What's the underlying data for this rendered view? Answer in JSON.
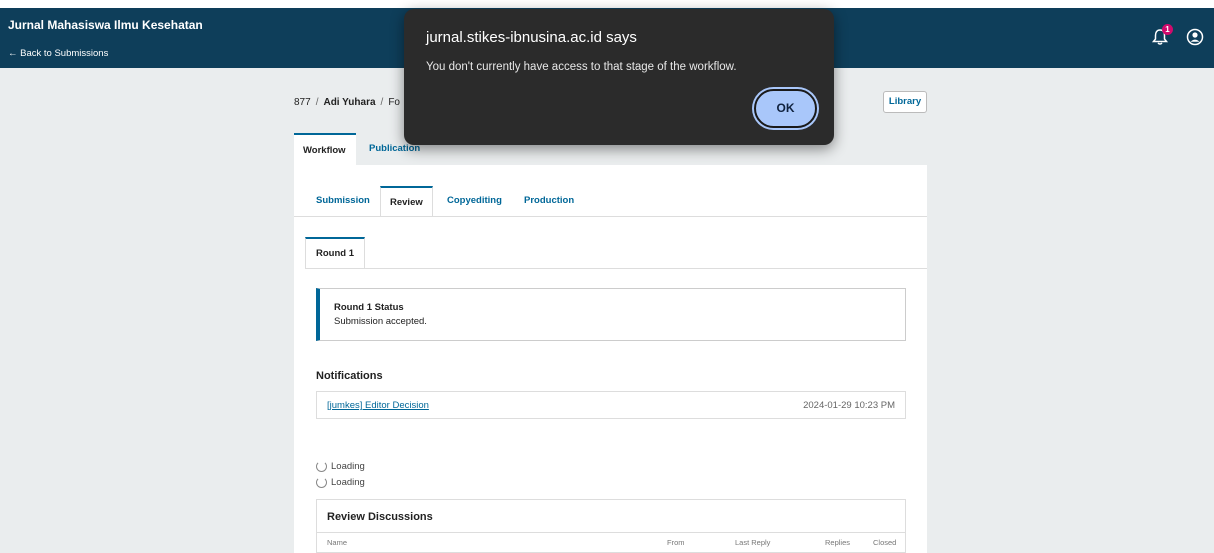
{
  "header": {
    "journal_title": "Jurnal Mahasiswa Ilmu Kesehatan",
    "back_link": "← Back to Submissions",
    "notification_count": "1",
    "color": "#0e3e5a"
  },
  "breadcrumb": {
    "id": "877",
    "author": "Adi Yuhara",
    "title_fragment": "Fo"
  },
  "library_button": "Library",
  "main_tabs": [
    {
      "label": "Workflow",
      "active": true
    },
    {
      "label": "Publication",
      "active": false
    }
  ],
  "stage_tabs": [
    {
      "label": "Submission",
      "active": false
    },
    {
      "label": "Review",
      "active": true
    },
    {
      "label": "Copyediting",
      "active": false
    },
    {
      "label": "Production",
      "active": false
    }
  ],
  "round_tab": "Round 1",
  "status": {
    "title": "Round 1 Status",
    "text": "Submission accepted."
  },
  "notifications": {
    "heading": "Notifications",
    "items": [
      {
        "link": "[jumkes] Editor Decision",
        "date": "2024-01-29 10:23 PM"
      }
    ]
  },
  "loading": [
    "Loading",
    "Loading"
  ],
  "discussions": {
    "title": "Review Discussions",
    "columns": [
      "Name",
      "From",
      "Last Reply",
      "Replies",
      "Closed"
    ]
  },
  "dialog": {
    "title": "jurnal.stikes-ibnusina.ac.id says",
    "message": "You don't currently have access to that stage of the workflow.",
    "ok_label": "OK"
  },
  "colors": {
    "accent": "#006798",
    "dialog_bg": "#2b2b2b",
    "ok_button": "#a9c7fa"
  }
}
